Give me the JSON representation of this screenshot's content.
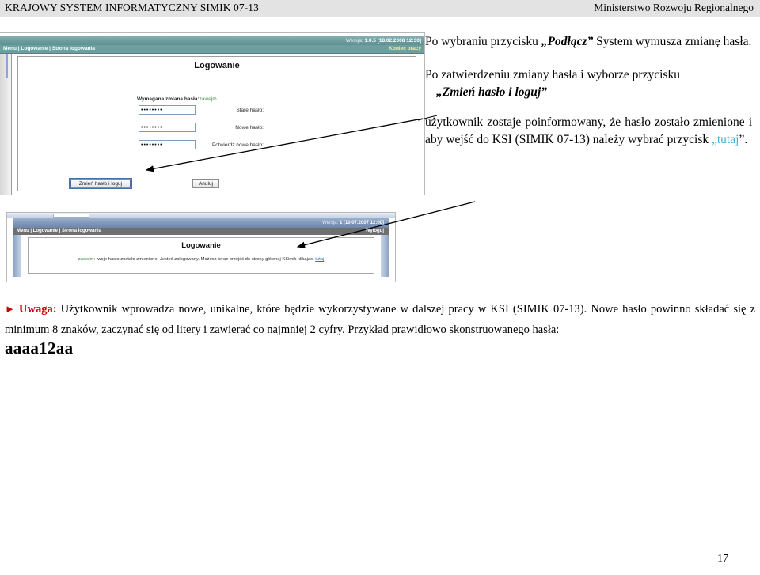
{
  "header": {
    "left": "KRAJOWY SYSTEM INFORMATYCZNY SIMIK 07-13",
    "right": "Ministerstwo Rozwoju Regionalnego"
  },
  "screenshot_password_change": {
    "version_label": "Wersja:",
    "version_value": "1.0.5 [18.02.2008 12:30]",
    "nav_breadcrumb": "Menu | Logowanie | Strona logowania",
    "nav_logout": "Koniec pracy",
    "page_title": "Logowanie",
    "required_change_note": "Wymagana zmiana hasła:",
    "required_change_user": "zawejm",
    "fields": [
      {
        "label": "Stare hasło:",
        "value": "••••••••",
        "name": "old-password"
      },
      {
        "label": "Nowe hasło:",
        "value": "••••••••",
        "name": "new-password"
      },
      {
        "label": "Potwierdź nowe hasło:",
        "value": "••••••••",
        "name": "confirm-password"
      }
    ],
    "submit_label": "Zmień hasło i loguj",
    "cancel_label": "Anuluj"
  },
  "screenshot_confirmation": {
    "version_label": "Wersja:",
    "version_value": "1 [10.07.2007 12:00]",
    "nav_breadcrumb": "Menu | Logowanie | Strona logowania",
    "nav_logout": "Wyloguj",
    "page_title": "Logowanie",
    "message_user": "zawejm",
    "message_body": ": twoje hasło zostało zmienione. Jesteś zalogowany. Możesz teraz przejść do strony głównej KSimik klikając:",
    "message_link": "tutaj"
  },
  "body": {
    "para1_pre": "Po wybraniu przycisku ",
    "para1_emph": "„Podłącz”",
    "para1_post": " System    wymusza zmianę hasła.",
    "para2": "Po zatwierdzeniu zmiany hasła i wyborze przycisku",
    "para3_emph": "„Zmień hasło i loguj”",
    "para4_pre": "użytkownik zostaje poinformowany, że hasło zostało zmienione i aby wejść do KSI (SIMIK 07-13) należy wybrać przycisk ",
    "para4_link": "„tutaj",
    "para4_post": "”."
  },
  "note": {
    "bullet": "►",
    "label": "Uwaga:",
    "text": " Użytkownik wprowadza nowe, unikalne, które będzie wykorzystywane w dalszej pracy w KSI (SIMIK 07-13). Nowe hasło powinno składać się z minimum 8 znaków, zaczynać się od litery i zawierać co najmniej 2 cyfry. Przykład prawidłowo skonstruowanego hasła:",
    "example_password": "aaaa12aa"
  },
  "footer": {
    "page_number": "17"
  },
  "colors": {
    "header_band": "#e3e3e3",
    "shot1_accent": "#6f9ea0",
    "shot2_accent": "#7d95b8",
    "note_red": "#cc0000",
    "link_blue": "#3fb3d6",
    "success_green": "#3f8f3f"
  }
}
